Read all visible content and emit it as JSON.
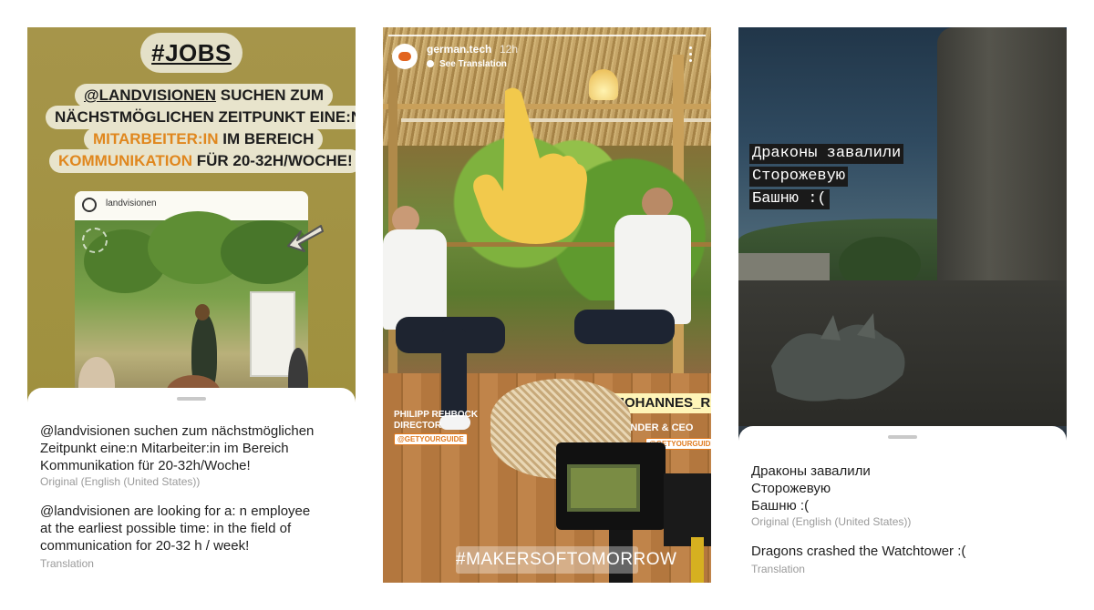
{
  "panel1": {
    "jobs_tag": "#JOBS",
    "headline": {
      "line1_mention": "@LANDVISIONEN",
      "line1_rest": " SUCHEN ZUM",
      "line2": "NÄCHSTMÖGLICHEN ZEITPUNKT EINE:N",
      "line3_orange": "MITARBEITER:IN",
      "line3_rest": " IM BEREICH",
      "line4_orange": "KOMMUNIKATION",
      "line4_rest": " FÜR 20-32H/WOCHE!"
    },
    "post_username": "landvisionen",
    "original_text": [
      "@landvisionen suchen zum nächstmöglichen",
      "Zeitpunkt eine:n Mitarbeiter:in im Bereich",
      "Kommunikation für 20-32h/Woche!"
    ],
    "original_note": "Original (English (United States))",
    "translation_text": [
      "@landvisionen are looking for a: n employee",
      "at the earliest possible time: in the field of",
      "communication for 20-32 h / week!"
    ],
    "translation_note": "Translation"
  },
  "panel2": {
    "account": "german.tech",
    "time": "12h",
    "see_translation": "See Translation",
    "left_name": "PHILIPP REHBOCK",
    "left_role": "DIRECTOR",
    "left_handle": "@GETYOURGUIDE",
    "right_tag": "@JOHANNES_RECK",
    "right_role": "CO-FOUNDER & CEO",
    "right_handle": "@GETYOURGUIDE",
    "hashtag": "#MAKERSOFTOMORROW",
    "accent": "#e07a1e"
  },
  "panel3": {
    "story_lines": [
      "Драконы завалили",
      "Сторожевую",
      "Башню :("
    ],
    "original_text": [
      "Драконы завалили",
      "Сторожевую",
      "Башню :("
    ],
    "original_note": "Original (English (United States))",
    "translation_text": "Dragons crashed the Watchtower :(",
    "translation_note": "Translation"
  }
}
